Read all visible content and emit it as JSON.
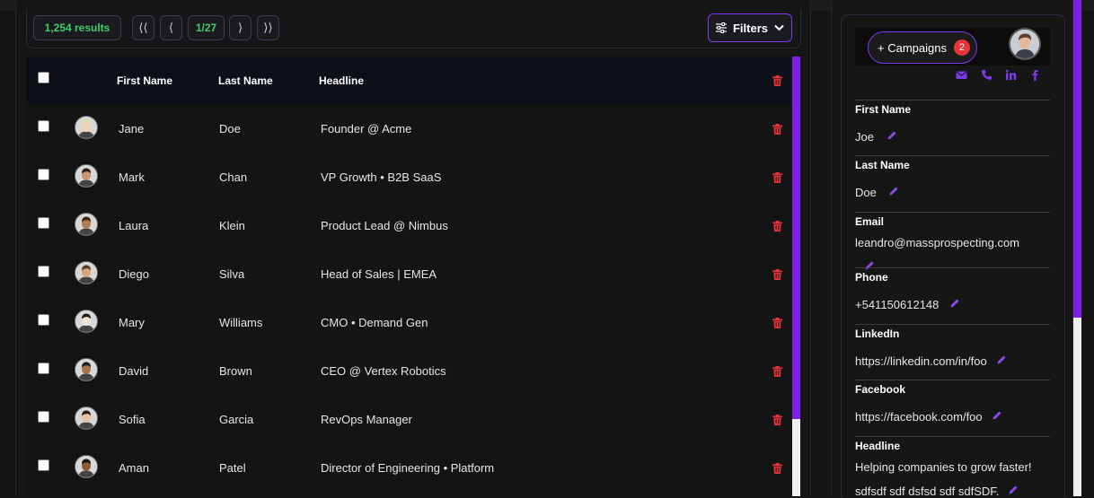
{
  "toolbar": {
    "results_label": "1,254 results",
    "first_label": "⟨⟨",
    "prev_label": "⟨",
    "page_label": "1/27",
    "next_label": "⟩",
    "last_label": "⟩⟩",
    "filters_label": "Filters"
  },
  "table": {
    "columns": {
      "first_name": "First Name",
      "last_name": "Last Name",
      "headline": "Headline"
    },
    "rows": [
      {
        "first": "Jane",
        "last": "Doe",
        "headline": "Founder @ Acme"
      },
      {
        "first": "Mark",
        "last": "Chan",
        "headline": "VP Growth • B2B SaaS"
      },
      {
        "first": "Laura",
        "last": "Klein",
        "headline": "Product Lead @ Nimbus"
      },
      {
        "first": "Diego",
        "last": "Silva",
        "headline": "Head of Sales | EMEA"
      },
      {
        "first": "Mary",
        "last": "Williams",
        "headline": "CMO • Demand Gen"
      },
      {
        "first": "David",
        "last": "Brown",
        "headline": "CEO @ Vertex Robotics"
      },
      {
        "first": "Sofia",
        "last": "Garcia",
        "headline": "RevOps Manager"
      },
      {
        "first": "Aman",
        "last": "Patel",
        "headline": "Director of Engineering • Platform"
      }
    ]
  },
  "profile": {
    "campaigns_label": "+ Campaigns",
    "campaigns_count": "2",
    "social_icons": [
      "email-icon",
      "phone-icon",
      "linkedin-icon",
      "facebook-icon"
    ],
    "fields": {
      "first_name": {
        "label": "First Name",
        "value": "Joe"
      },
      "last_name": {
        "label": "Last Name",
        "value": "Doe"
      },
      "email": {
        "label": "Email",
        "value": "leandro@massprospecting.com"
      },
      "phone": {
        "label": "Phone",
        "value": "+541150612148"
      },
      "linkedin": {
        "label": "LinkedIn",
        "value": "https://linkedin.com/in/foo"
      },
      "facebook": {
        "label": "Facebook",
        "value": "https://facebook.com/foo"
      },
      "headline": {
        "label": "Headline",
        "value_line1": "Helping companies to grow faster!",
        "value_line2": "sdfsdf sdf dsfsd sdf sdfSDF."
      }
    }
  },
  "colors": {
    "accent": "#7c3aed",
    "scrollbar": "#7c20e6",
    "results_green": "#3ecf6b",
    "delete_red": "#e5343a",
    "header_bg": "#0d1117"
  }
}
